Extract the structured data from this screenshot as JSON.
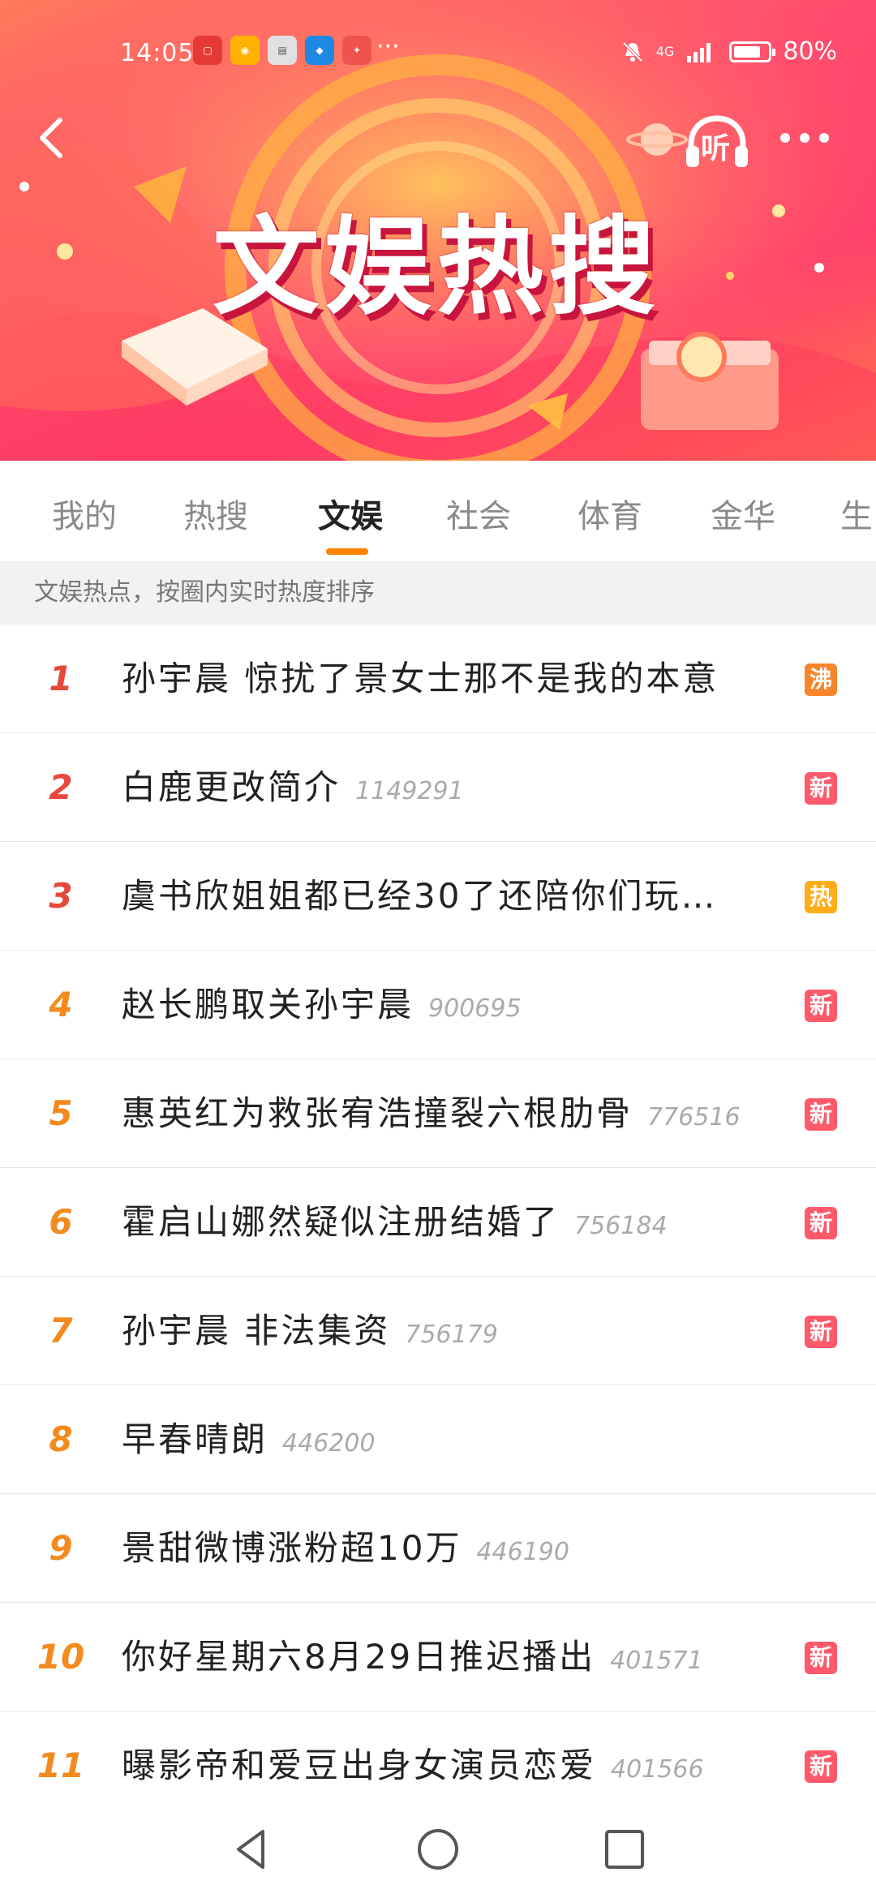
{
  "status_bar": {
    "time": "14:05",
    "more_indicator": "···",
    "network": "4G",
    "battery_percent": "80%",
    "battery_level": 0.8,
    "app_icons": [
      "huawei-app-icon",
      "weibo-icon",
      "box-icon",
      "bird-app-icon",
      "red-app-icon"
    ]
  },
  "banner": {
    "title": "文娱热搜",
    "listen_label": "听"
  },
  "tabs": [
    {
      "label": "我的",
      "active": false
    },
    {
      "label": "热搜",
      "active": false
    },
    {
      "label": "文娱",
      "active": true
    },
    {
      "label": "社会",
      "active": false
    },
    {
      "label": "体育",
      "active": false
    },
    {
      "label": "金华",
      "active": false
    },
    {
      "label": "生",
      "active": false
    }
  ],
  "description": "文娱热点，按圈内实时热度排序",
  "list": [
    {
      "rank": "1",
      "title": "孙宇晨 惊扰了景女士那不是我的本意",
      "heat": "",
      "badge": "沸",
      "badge_color": "#f7852a"
    },
    {
      "rank": "2",
      "title": "白鹿更改简介",
      "heat": "1149291",
      "badge": "新",
      "badge_color": "#ff5a6b"
    },
    {
      "rank": "3",
      "title": "虞书欣姐姐都已经30了还陪你们玩…",
      "heat": "",
      "badge": "热",
      "badge_color": "#ffad1a"
    },
    {
      "rank": "4",
      "title": "赵长鹏取关孙宇晨",
      "heat": "900695",
      "badge": "新",
      "badge_color": "#ff5a6b"
    },
    {
      "rank": "5",
      "title": "惠英红为救张宥浩撞裂六根肋骨",
      "heat": "776516",
      "badge": "新",
      "badge_color": "#ff5a6b"
    },
    {
      "rank": "6",
      "title": "霍启山娜然疑似注册结婚了",
      "heat": "756184",
      "badge": "新",
      "badge_color": "#ff5a6b"
    },
    {
      "rank": "7",
      "title": "孙宇晨 非法集资",
      "heat": "756179",
      "badge": "新",
      "badge_color": "#ff5a6b"
    },
    {
      "rank": "8",
      "title": "早春晴朗",
      "heat": "446200",
      "badge": "",
      "badge_color": ""
    },
    {
      "rank": "9",
      "title": "景甜微博涨粉超10万",
      "heat": "446190",
      "badge": "",
      "badge_color": ""
    },
    {
      "rank": "10",
      "title": "你好星期六8月29日推迟播出",
      "heat": "401571",
      "badge": "新",
      "badge_color": "#ff5a6b"
    },
    {
      "rank": "11",
      "title": "曝影帝和爱豆出身女演员恋爱",
      "heat": "401566",
      "badge": "新",
      "badge_color": "#ff5a6b"
    }
  ],
  "colors": {
    "accent": "#ff8200",
    "top_rank": "#e8473c",
    "rank": "#f28a1e"
  }
}
